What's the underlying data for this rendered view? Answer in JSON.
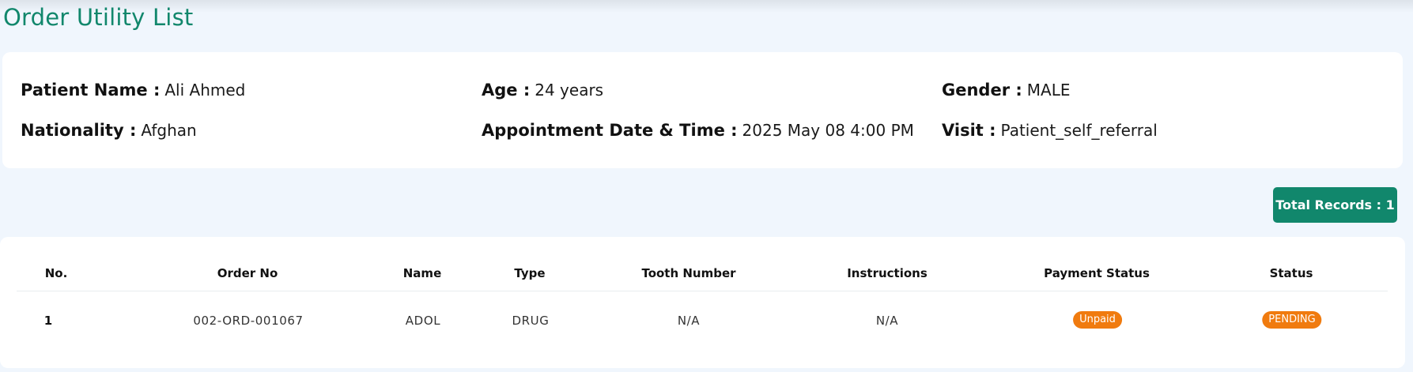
{
  "page": {
    "title": "Order Utility List"
  },
  "patient": {
    "name_label": "Patient Name :",
    "name_value": "Ali Ahmed",
    "age_label": "Age :",
    "age_value": "24 years",
    "gender_label": "Gender :",
    "gender_value": "MALE",
    "nationality_label": "Nationality :",
    "nationality_value": "Afghan",
    "appointment_label": "Appointment Date & Time :",
    "appointment_value": "2025 May 08 4:00 PM",
    "visit_label": "Visit :",
    "visit_value": "Patient_self_referral"
  },
  "summary": {
    "total_records": "Total Records : 1"
  },
  "table": {
    "columns": [
      "No.",
      "Order No",
      "Name",
      "Type",
      "Tooth Number",
      "Instructions",
      "Payment Status",
      "Status"
    ],
    "rows": [
      {
        "no": "1",
        "order_no": "002-ORD-001067",
        "name": "ADOL",
        "type": "DRUG",
        "tooth_number": "N/A",
        "instructions": "N/A",
        "payment_status": "Unpaid",
        "status": "PENDING"
      }
    ]
  },
  "colors": {
    "accent": "#11876c",
    "background": "#f0f6fd",
    "card": "#ffffff",
    "status_badge": "#f07b0f"
  }
}
